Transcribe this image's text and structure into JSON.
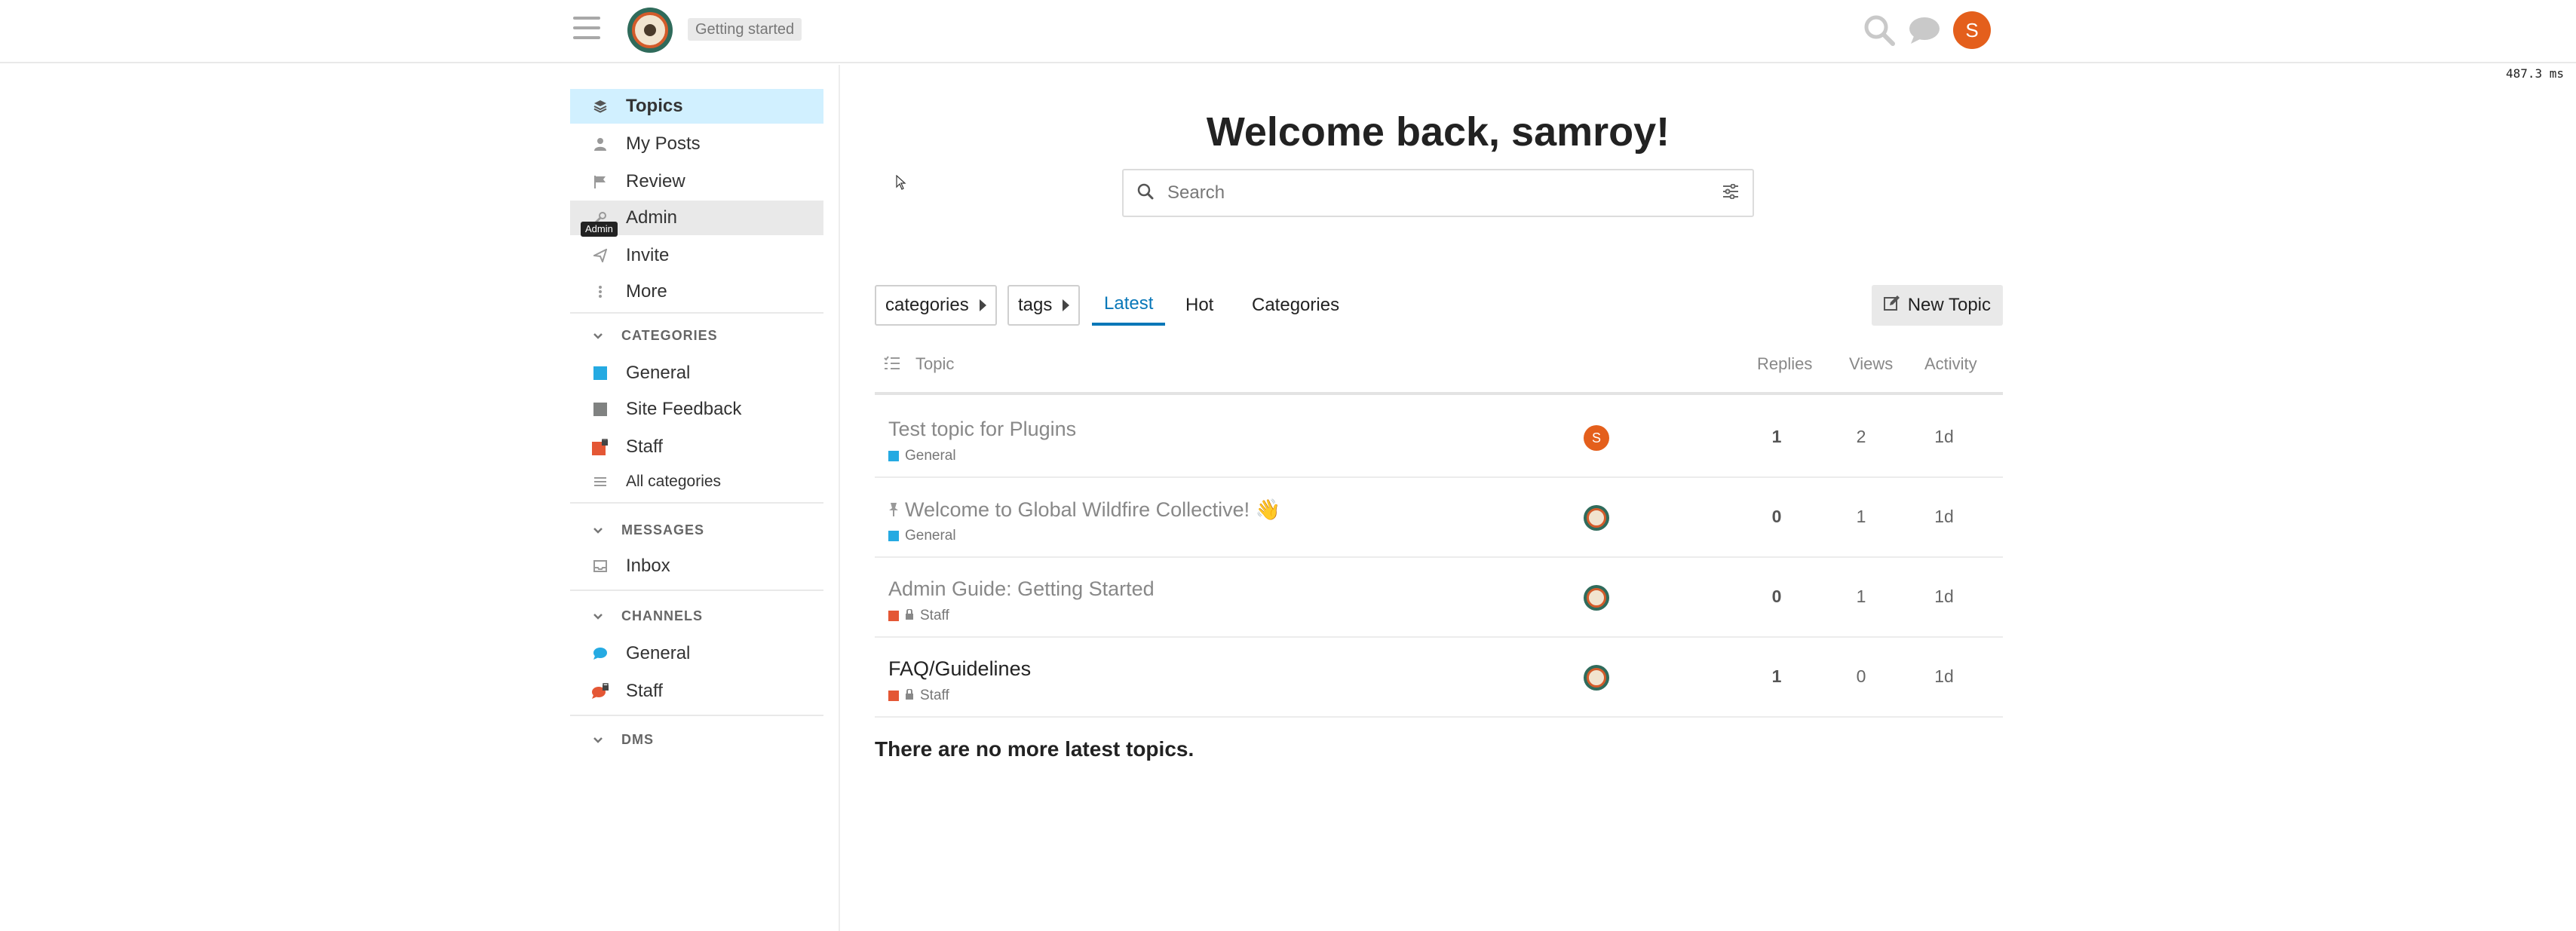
{
  "header": {
    "getting_started": "Getting started",
    "user_initial": "S"
  },
  "timing": "487.3 ms",
  "sidebar": {
    "nav": [
      {
        "label": "Topics",
        "icon": "layers-icon"
      },
      {
        "label": "My Posts",
        "icon": "user-icon"
      },
      {
        "label": "Review",
        "icon": "flag-icon"
      },
      {
        "label": "Admin",
        "icon": "wrench-icon"
      },
      {
        "label": "Invite",
        "icon": "paper-plane-icon"
      },
      {
        "label": "More",
        "icon": "ellipsis-vertical-icon"
      }
    ],
    "tooltip": "Admin",
    "categories_head": "CATEGORIES",
    "categories": [
      {
        "label": "General",
        "color": "#25AAE2"
      },
      {
        "label": "Site Feedback",
        "color": "#808281"
      },
      {
        "label": "Staff",
        "color": "#E45735"
      }
    ],
    "all_categories": "All categories",
    "messages_head": "MESSAGES",
    "inbox": "Inbox",
    "channels_head": "CHANNELS",
    "channels": [
      {
        "label": "General",
        "color": "#25AAE2"
      },
      {
        "label": "Staff",
        "color": "#E45735"
      }
    ],
    "dms_head": "DMS"
  },
  "main": {
    "welcome": "Welcome back, samroy!",
    "search_placeholder": "Search",
    "filters": {
      "categories": "categories",
      "tags": "tags"
    },
    "tabs": [
      "Latest",
      "Hot",
      "Categories"
    ],
    "new_topic": "New Topic",
    "columns": {
      "topic": "Topic",
      "replies": "Replies",
      "views": "Views",
      "activity": "Activity"
    },
    "topics": [
      {
        "title": "Test topic for Plugins",
        "category": "General",
        "cat_color": "#25AAE2",
        "locked": false,
        "pinned": false,
        "replies": "1",
        "views": "2",
        "activity": "1d",
        "unread": false,
        "poster": "S"
      },
      {
        "title": "Welcome to Global Wildfire Collective! 👋",
        "category": "General",
        "cat_color": "#25AAE2",
        "locked": false,
        "pinned": true,
        "replies": "0",
        "views": "1",
        "activity": "1d",
        "unread": false,
        "poster": "logo"
      },
      {
        "title": "Admin Guide: Getting Started",
        "category": "Staff",
        "cat_color": "#E45735",
        "locked": true,
        "pinned": false,
        "replies": "0",
        "views": "1",
        "activity": "1d",
        "unread": false,
        "poster": "logo"
      },
      {
        "title": "FAQ/Guidelines",
        "category": "Staff",
        "cat_color": "#E45735",
        "locked": true,
        "pinned": false,
        "replies": "1",
        "views": "0",
        "activity": "1d",
        "unread": true,
        "poster": "logo"
      }
    ],
    "no_more": "There are no more latest topics."
  }
}
